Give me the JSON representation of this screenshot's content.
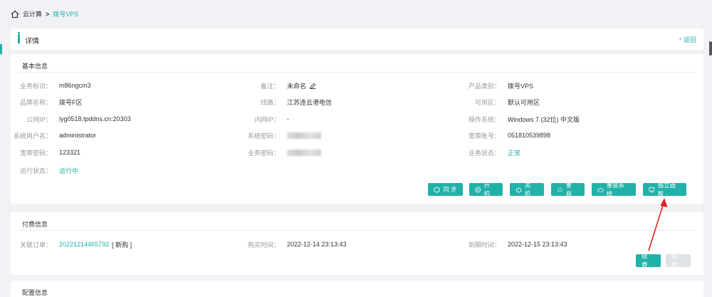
{
  "breadcrumb": {
    "root": "云计算",
    "sep": ">",
    "current": "拨号VPS"
  },
  "header": {
    "title": "详情",
    "back_label": "返回"
  },
  "basic": {
    "title": "基本信息",
    "col1": [
      {
        "k": "业务标识：",
        "v": "m86ngcm3"
      },
      {
        "k": "品牌名称：",
        "v": "拨号F区"
      },
      {
        "k": "公网IP：",
        "v": "lyg0518.tpddns.cn:20303"
      },
      {
        "k": "系统用户名：",
        "v": "administrator"
      },
      {
        "k": "宽带密码：",
        "v": "123321"
      },
      {
        "k": "运行状态：",
        "v": "运行中"
      }
    ],
    "col2": [
      {
        "k": "备注：",
        "v": "未命名"
      },
      {
        "k": "线路：",
        "v": "江苏连云港电信"
      },
      {
        "k": "内网IP：",
        "v": "-"
      },
      {
        "k": "系统密码：",
        "v": ""
      },
      {
        "k": "业务密码：",
        "v": ""
      }
    ],
    "col3": [
      {
        "k": "产品类别：",
        "v": "拨号VPS"
      },
      {
        "k": "可用区：",
        "v": "默认可用区"
      },
      {
        "k": "操作系统：",
        "v": "Windows 7 (32位) 中文版"
      },
      {
        "k": "宽带账号：",
        "v": "051810539898"
      },
      {
        "k": "业务状态：",
        "v": "正常"
      }
    ],
    "buttons": {
      "sync": "同 步",
      "power_on": "开 机",
      "power_off": "关 机",
      "restart": "重 启",
      "reinstall": "重装系统",
      "panel": "独立面板"
    }
  },
  "pay": {
    "title": "付费信息",
    "order_k": "关联订单：",
    "order_v": "20221214465792",
    "order_tag": "[ 新购 ]",
    "buy_k": "购买时间：",
    "buy_v": "2022-12-14 23:13:43",
    "expire_k": "到期时间：",
    "expire_v": "2022-12-15 23:13:43",
    "renew": "续 费",
    "refund": "退 款"
  },
  "config": {
    "title": "配置信息"
  },
  "colors": {
    "accent": "#21b1a8",
    "arrow": "#e02020"
  }
}
